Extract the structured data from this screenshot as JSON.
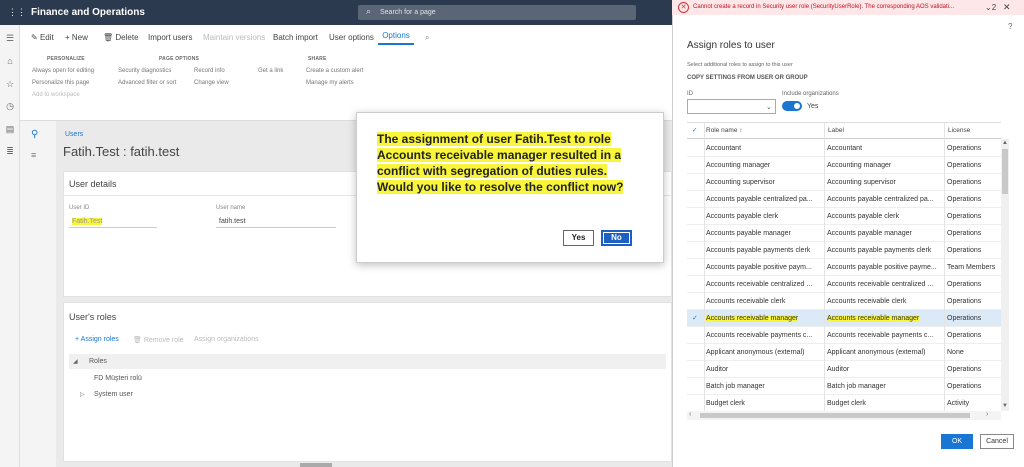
{
  "app": {
    "title": "Finance and Operations",
    "search_placeholder": "Search for a page"
  },
  "actionpane": {
    "buttons": [
      {
        "icon": "edit-icon",
        "label": "Edit"
      },
      {
        "icon": "plus-icon",
        "label": "New"
      },
      {
        "icon": "delete-icon",
        "label": "Delete"
      },
      {
        "label": "Import users"
      },
      {
        "label": "Maintain versions"
      },
      {
        "label": "Batch import"
      },
      {
        "label": "User options"
      }
    ],
    "options_tab": "Options",
    "groups": {
      "personalize": {
        "header": "PERSONALIZE",
        "items": [
          "Always open for editing",
          "Personalize this page",
          "Add to workspace"
        ]
      },
      "page_options": {
        "header": "PAGE OPTIONS",
        "col1": [
          "Security diagnostics",
          "Advanced filter or sort"
        ],
        "col2": [
          "Record info",
          "Change view"
        ],
        "col3": [
          "Get a link"
        ]
      },
      "share": {
        "header": "SHARE",
        "items": [
          "Create a custom alert",
          "Manage my alerts"
        ]
      }
    }
  },
  "main": {
    "breadcrumb": "Users",
    "page_title": "Fatih.Test : fatih.test",
    "user_details": {
      "title": "User details",
      "user_id_label": "User ID",
      "user_id_value": "Fatih.Test",
      "user_name_label": "User name",
      "user_name_value": "fatih.test"
    },
    "user_roles": {
      "title": "User's roles",
      "assign_roles": "Assign roles",
      "remove_role": "Remove role",
      "assign_orgs": "Assign organizations",
      "tree_root": "Roles",
      "tree_items": [
        "FD Müşteri rolü",
        "System user"
      ]
    }
  },
  "dialog": {
    "message": "The assignment of user Fatih.Test to role Accounts receivable manager resulted in a conflict with segregation of duties rules. Would you like to resolve the conflict now?",
    "yes": "Yes",
    "no": "No"
  },
  "panel": {
    "error": "Cannot create a record in Security user role (SecurityUserRole). The corresponding AOS validati...",
    "error_count": "2",
    "help": "?",
    "title": "Assign roles to user",
    "subtitle": "Select additional roles to assign to this user",
    "copy_settings": "COPY SETTINGS FROM USER OR GROUP",
    "id_label": "ID",
    "include_orgs_label": "Include organizations",
    "toggle_value": "Yes",
    "columns": [
      "Role name",
      "Label",
      "License"
    ],
    "rows": [
      {
        "name": "Accountant",
        "label": "Accountant",
        "license": "Operations"
      },
      {
        "name": "Accounting manager",
        "label": "Accounting manager",
        "license": "Operations"
      },
      {
        "name": "Accounting supervisor",
        "label": "Accounting supervisor",
        "license": "Operations"
      },
      {
        "name": "Accounts payable centralized pa...",
        "label": "Accounts payable centralized pa...",
        "license": "Operations"
      },
      {
        "name": "Accounts payable clerk",
        "label": "Accounts payable clerk",
        "license": "Operations"
      },
      {
        "name": "Accounts payable manager",
        "label": "Accounts payable manager",
        "license": "Operations"
      },
      {
        "name": "Accounts payable payments clerk",
        "label": "Accounts payable payments clerk",
        "license": "Operations"
      },
      {
        "name": "Accounts payable positive paym...",
        "label": "Accounts payable positive payme...",
        "license": "Team Members"
      },
      {
        "name": "Accounts receivable centralized ...",
        "label": "Accounts receivable centralized ...",
        "license": "Operations"
      },
      {
        "name": "Accounts receivable clerk",
        "label": "Accounts receivable clerk",
        "license": "Operations"
      },
      {
        "name": "Accounts receivable manager",
        "label": "Accounts receivable manager",
        "license": "Operations",
        "selected": true
      },
      {
        "name": "Accounts receivable payments c...",
        "label": "Accounts receivable payments c...",
        "license": "Operations"
      },
      {
        "name": "Applicant anonymous (external)",
        "label": "Applicant anonymous (external)",
        "license": "None"
      },
      {
        "name": "Auditor",
        "label": "Auditor",
        "license": "Operations"
      },
      {
        "name": "Batch job manager",
        "label": "Batch job manager",
        "license": "Operations"
      },
      {
        "name": "Budget clerk",
        "label": "Budget clerk",
        "license": "Activity"
      }
    ],
    "ok": "OK",
    "cancel": "Cancel"
  }
}
